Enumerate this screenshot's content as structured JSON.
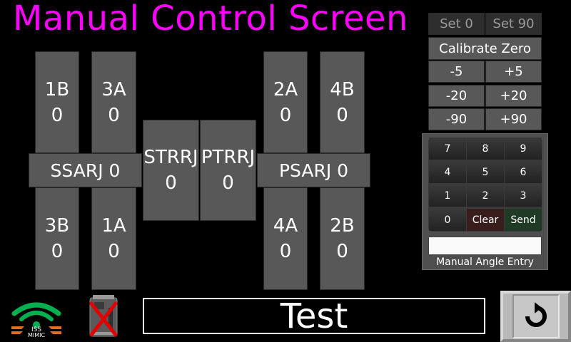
{
  "title": "Manual Control Screen",
  "joints": {
    "b1b": {
      "name": "1B",
      "value": "0"
    },
    "a3a": {
      "name": "3A",
      "value": "0"
    },
    "b3b": {
      "name": "3B",
      "value": "0"
    },
    "a1a": {
      "name": "1A",
      "value": "0"
    },
    "a2a": {
      "name": "2A",
      "value": "0"
    },
    "b4b": {
      "name": "4B",
      "value": "0"
    },
    "a4a": {
      "name": "4A",
      "value": "0"
    },
    "b2b": {
      "name": "2B",
      "value": "0"
    },
    "strrj": {
      "name": "STRRJ",
      "value": "0"
    },
    "ptrrj": {
      "name": "PTRRJ",
      "value": "0"
    }
  },
  "ssarj_label": "SSARJ 0",
  "psarj_label": "PSARJ 0",
  "controls": {
    "set0": "Set 0",
    "set90": "Set 90",
    "calibrate": "Calibrate Zero",
    "minus5": "-5",
    "plus5": "+5",
    "minus20": "-20",
    "plus20": "+20",
    "minus90": "-90",
    "plus90": "+90"
  },
  "keypad": {
    "k7": "7",
    "k8": "8",
    "k9": "9",
    "k4": "4",
    "k5": "5",
    "k6": "6",
    "k1": "1",
    "k2": "2",
    "k3": "3",
    "k0": "0",
    "clear": "Clear",
    "send": "Send"
  },
  "entry_label": "Manual Angle Entry",
  "entry_value": "",
  "status_text": "Test",
  "logo_text": "ISS MIMIC",
  "colors": {
    "title": "#ff00ff",
    "button": "#585858",
    "logo_green": "#00b050",
    "logo_orange": "#e07020",
    "error_red": "#e00000"
  }
}
